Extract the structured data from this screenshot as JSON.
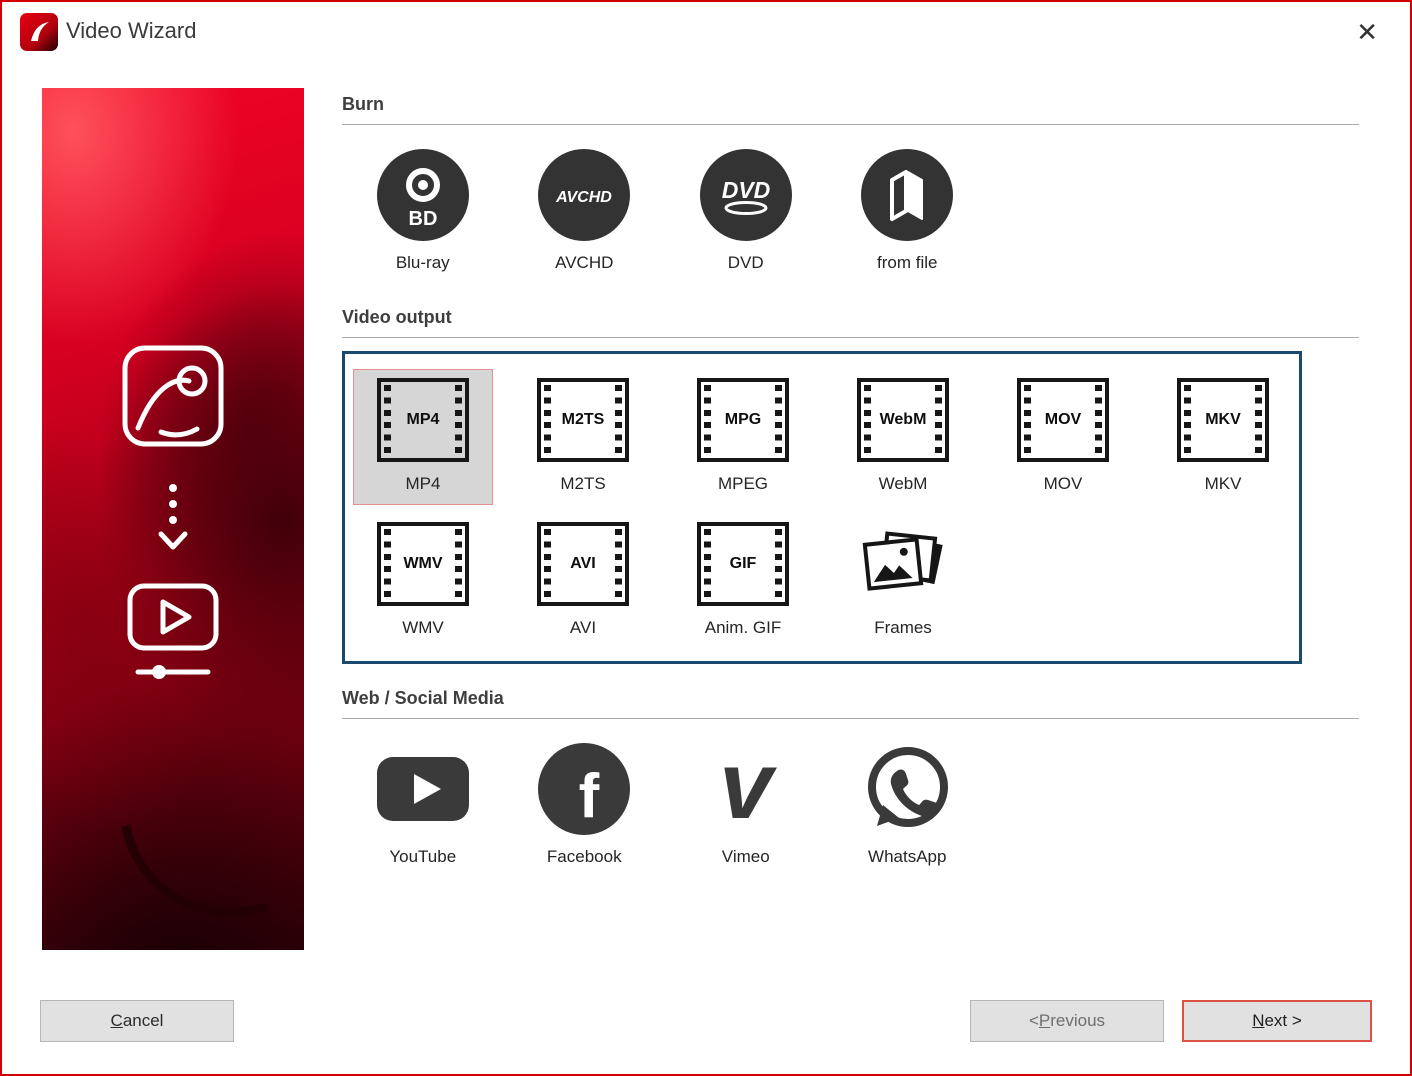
{
  "window": {
    "title": "Video Wizard",
    "close_glyph": "✕"
  },
  "sections": {
    "burn": {
      "title": "Burn",
      "items": [
        {
          "label": "Blu-ray",
          "icon": "bluray-disc",
          "glyph": "BD"
        },
        {
          "label": "AVCHD",
          "icon": "avchd-disc",
          "glyph": "AVCHD"
        },
        {
          "label": "DVD",
          "icon": "dvd-disc",
          "glyph": "DVD"
        },
        {
          "label": "from file",
          "icon": "from-file-disc",
          "glyph": ""
        }
      ]
    },
    "video_output": {
      "title": "Video output",
      "items": [
        {
          "label": "MP4",
          "badge": "MP4",
          "selected": true
        },
        {
          "label": "M2TS",
          "badge": "M2TS"
        },
        {
          "label": "MPEG",
          "badge": "MPG"
        },
        {
          "label": "WebM",
          "badge": "WebM"
        },
        {
          "label": "MOV",
          "badge": "MOV"
        },
        {
          "label": "MKV",
          "badge": "MKV"
        },
        {
          "label": "WMV",
          "badge": "WMV"
        },
        {
          "label": "AVI",
          "badge": "AVI"
        },
        {
          "label": "Anim. GIF",
          "badge": "GIF"
        },
        {
          "label": "Frames",
          "icon": "photo-stack"
        }
      ]
    },
    "web": {
      "title": "Web / Social Media",
      "items": [
        {
          "label": "YouTube",
          "icon": "youtube"
        },
        {
          "label": "Facebook",
          "icon": "facebook",
          "glyph": "f"
        },
        {
          "label": "Vimeo",
          "icon": "vimeo",
          "glyph": "v"
        },
        {
          "label": "WhatsApp",
          "icon": "whatsapp"
        }
      ]
    }
  },
  "footer": {
    "cancel": {
      "pre": "",
      "key": "C",
      "post": "ancel"
    },
    "previous": {
      "pre": "< ",
      "key": "P",
      "post": "revious"
    },
    "next": {
      "pre": "",
      "key": "N",
      "post": "ext >"
    }
  },
  "colors": {
    "window_border": "#d30000",
    "selection_frame": "#1b4a70",
    "selected_border": "#e58f8f",
    "selected_bg": "#d6d6d6",
    "icon_dark": "#333333",
    "next_focus_border": "#dd5044"
  }
}
